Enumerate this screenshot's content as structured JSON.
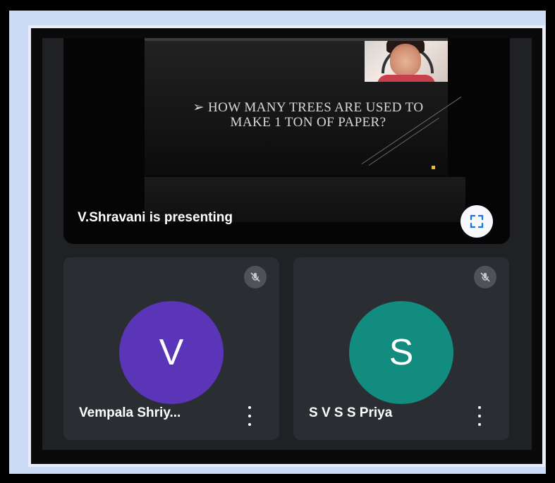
{
  "presentation": {
    "slide_text": "➢ HOW MANY TREES ARE USED TO  MAKE 1 TON OF PAPER?",
    "presenting_label": "V.Shravani is presenting"
  },
  "participants": [
    {
      "initial": "V",
      "name": "Vempala Shriy...",
      "avatar_color": "#5a35b8"
    },
    {
      "initial": "S",
      "name": "S V S S Priya",
      "avatar_color": "#118c7e"
    }
  ],
  "icons": {
    "fullscreen": "fullscreen-icon",
    "mute": "mic-off-icon",
    "menu": "more-vertical-icon"
  }
}
